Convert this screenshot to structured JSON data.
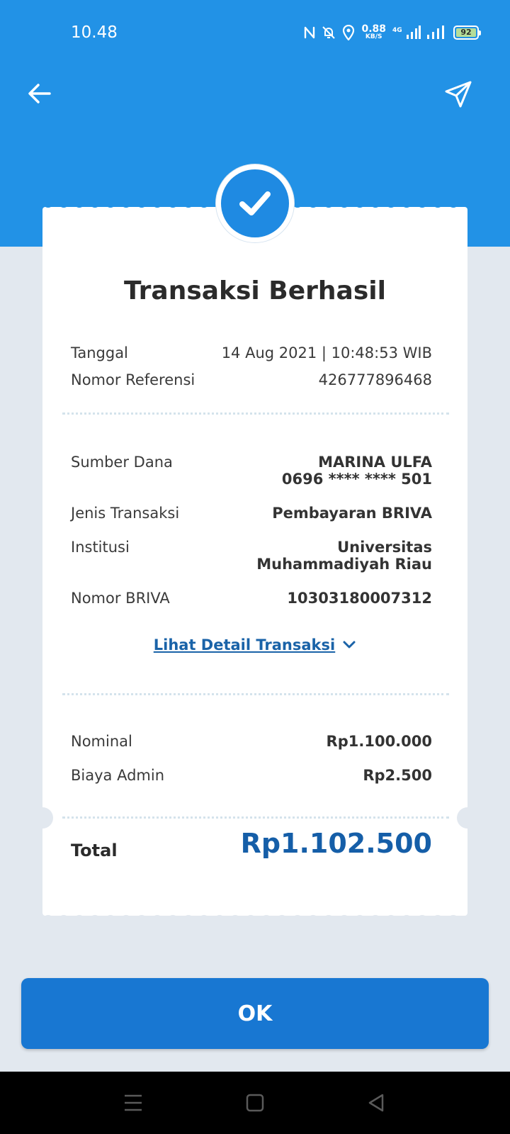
{
  "status_bar": {
    "time": "10.48",
    "net_speed": "0.88",
    "net_unit": "KB/S",
    "network_type": "4G",
    "battery": "92"
  },
  "icons": {
    "back": "back-arrow-icon",
    "share": "share-send-icon",
    "success": "checkmark-icon",
    "expand": "chevron-down-icon"
  },
  "receipt": {
    "title": "Transaksi Berhasil",
    "info": [
      {
        "label": "Tanggal",
        "value": "14 Aug 2021 | 10:48:53 WIB"
      },
      {
        "label": "Nomor Referensi",
        "value": "426777896468"
      }
    ],
    "details": {
      "source_label": "Sumber Dana",
      "source_name": "MARINA ULFA",
      "source_account": "0696 **** **** 501",
      "type_label": "Jenis Transaksi",
      "type_value": "Pembayaran BRIVA",
      "institution_label": "Institusi",
      "institution_line1": "Universitas",
      "institution_line2": "Muhammadiyah Riau",
      "briva_label": "Nomor BRIVA",
      "briva_value": "10303180007312"
    },
    "detail_link": "Lihat Detail Transaksi",
    "amounts": [
      {
        "label": "Nominal",
        "value": "Rp1.100.000"
      },
      {
        "label": "Biaya Admin",
        "value": "Rp2.500"
      }
    ],
    "total_label": "Total",
    "total_value": "Rp1.102.500"
  },
  "ok_button": "OK",
  "colors": {
    "header": "#2292e6",
    "background": "#e2e8ef",
    "primary_button": "#1877d2",
    "total_text": "#155ea8",
    "link": "#1a63a8"
  }
}
